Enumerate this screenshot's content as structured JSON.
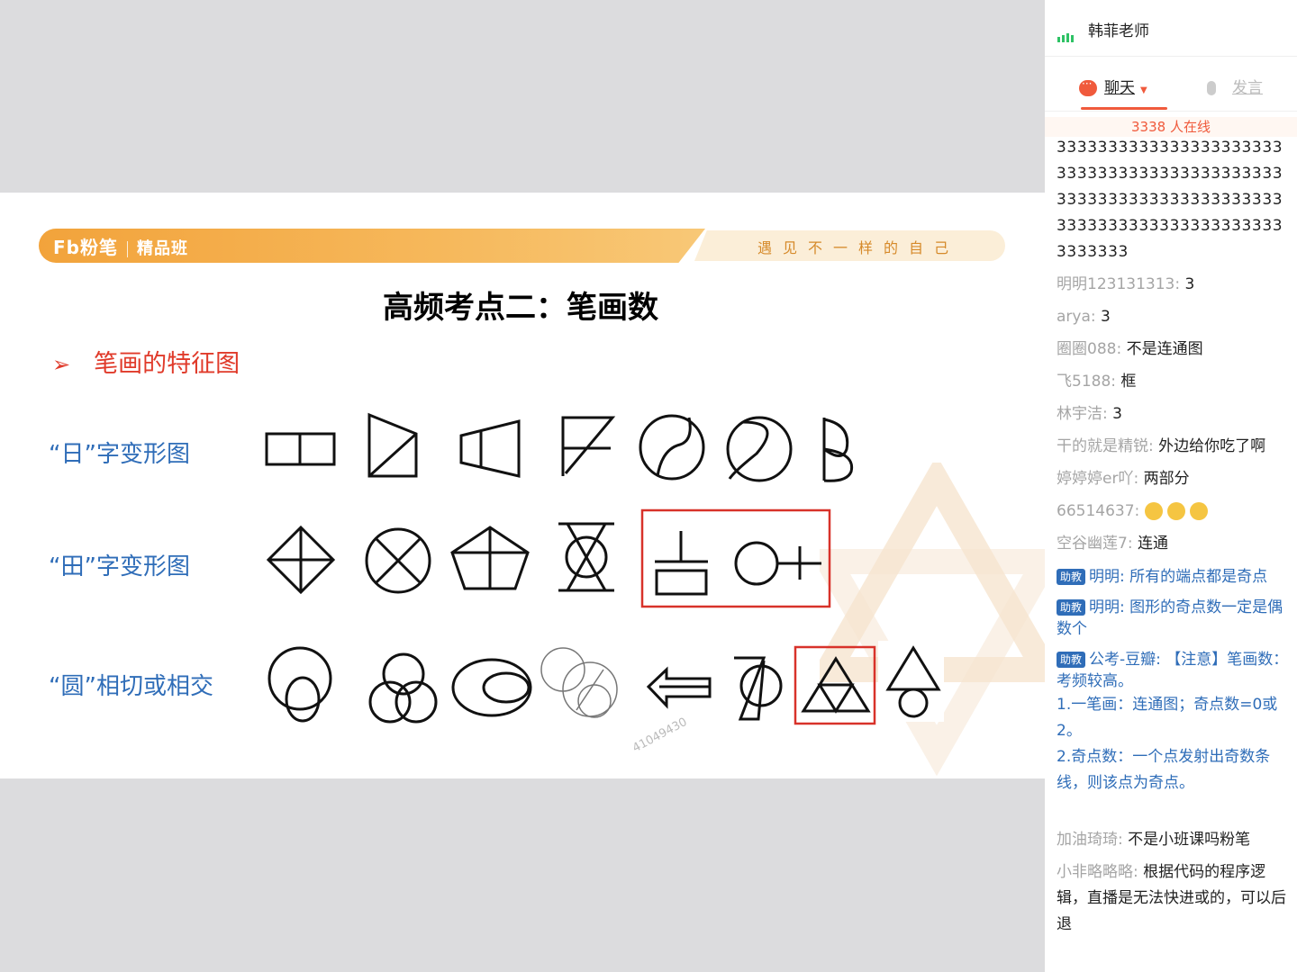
{
  "slide": {
    "brand": "Fb粉笔",
    "class_label": "精品班",
    "slogan": "遇见不一样的自己",
    "title": "高频考点二：笔画数",
    "bullet": "笔画的特征图",
    "rows": [
      "“日”字变形图",
      "“田”字变形图",
      "“圆”相切或相交"
    ],
    "watermark": "41049430"
  },
  "panel": {
    "teacher": "韩菲老师",
    "tab_chat": "聊天",
    "tab_speak": "发言",
    "online": "3338 人在线",
    "big_message": "33333333333333333333333333333333333333333333333333333333333333333333333333333333333333333333333",
    "messages": [
      {
        "nick": "明明123131313:",
        "text": "3"
      },
      {
        "nick": "arya:",
        "text": "3"
      },
      {
        "nick": "圈圈088:",
        "text": "不是连通图"
      },
      {
        "nick": "飞5188:",
        "text": "框"
      },
      {
        "nick": "林宇洁:",
        "text": "3"
      },
      {
        "nick": "干的就是精锐:",
        "text": "外边给你吃了啊"
      },
      {
        "nick": "婷婷婷er吖:",
        "text": "两部分"
      },
      {
        "nick": "66514637:",
        "text": ""
      },
      {
        "nick": "空谷幽莲7:",
        "text": "连通"
      }
    ],
    "assistant_badge": "助教",
    "assistant_messages": [
      {
        "text": "明明: 所有的端点都是奇点"
      },
      {
        "text": "明明: 图形的奇点数一定是偶数个"
      },
      {
        "text": "公考-豆瓣: 【注意】笔画数：考频较高。"
      }
    ],
    "assistant_lines": [
      "1.一笔画：连通图；奇点数=0或2。",
      "2.奇点数：一个点发射出奇数条线，则该点为奇点。"
    ],
    "messages2": [
      {
        "nick": "加油琦琦:",
        "text": "不是小班课吗粉笔"
      },
      {
        "nick": "小非略略略:",
        "text": "根据代码的程序逻辑，直播是无法快进或的，可以后退"
      }
    ]
  }
}
